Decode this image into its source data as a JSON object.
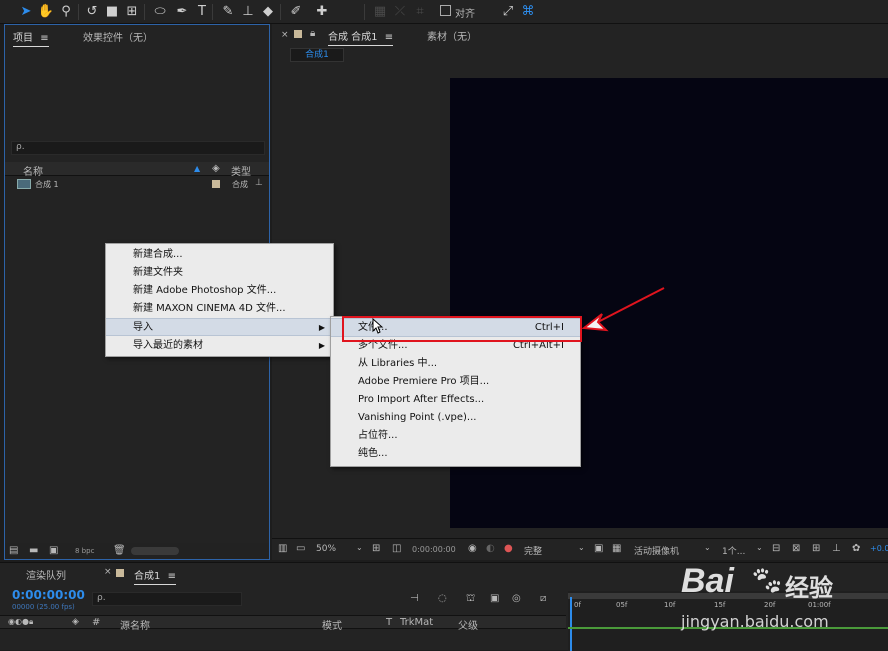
{
  "panels": {
    "project_tab": "项目",
    "effects_tab": "效果控件（无）",
    "comp_tab": "合成 合成1",
    "footage_tab": "素材（无）",
    "comp_subtab": "合成1",
    "align_label": "对齐"
  },
  "project": {
    "search_placeholder": "ρ.",
    "col_name": "名称",
    "col_type": "类型",
    "item_name": "合成 1",
    "item_type": "合成",
    "bpc": "8 bpc"
  },
  "viewer": {
    "zoom": "50%",
    "timecode": "0:00:00:00",
    "quality": "完整",
    "camera": "活动摄像机",
    "views": "1个...",
    "exposure": "+0.0"
  },
  "timeline": {
    "render_tab": "渲染队列",
    "comp_tab": "合成1",
    "timecode": "0:00:00:00",
    "fps": "00000 (25.00 fps)",
    "search_placeholder": "ρ.",
    "col_source": "源名称",
    "col_mode": "模式",
    "col_t": "T",
    "col_trkmat": "TrkMat",
    "col_parent": "父级",
    "ticks": [
      "0f",
      "05f",
      "10f",
      "15f",
      "20f",
      "01:00f"
    ]
  },
  "context_menu": {
    "items": [
      {
        "label": "新建合成..."
      },
      {
        "label": "新建文件夹"
      },
      {
        "label": "新建 Adobe Photoshop 文件..."
      },
      {
        "label": "新建 MAXON CINEMA 4D 文件..."
      },
      {
        "label": "导入"
      },
      {
        "label": "导入最近的素材"
      }
    ]
  },
  "submenu": {
    "items": [
      {
        "label": "文件...",
        "shortcut": "Ctrl+I"
      },
      {
        "label": "多个文件...",
        "shortcut": "Ctrl+Alt+I"
      },
      {
        "label": "从 Libraries 中..."
      },
      {
        "label": "Adobe Premiere Pro 项目..."
      },
      {
        "label": "Pro Import After Effects..."
      },
      {
        "label": "Vanishing Point (.vpe)..."
      },
      {
        "label": "占位符..."
      },
      {
        "label": "纯色..."
      }
    ]
  },
  "watermark": {
    "brand": "Bai",
    "brand_suffix": "经验",
    "url": "jingyan.baidu.com"
  },
  "colors": {
    "accent": "#2d8ceb",
    "annotation_red": "#e0141e"
  }
}
